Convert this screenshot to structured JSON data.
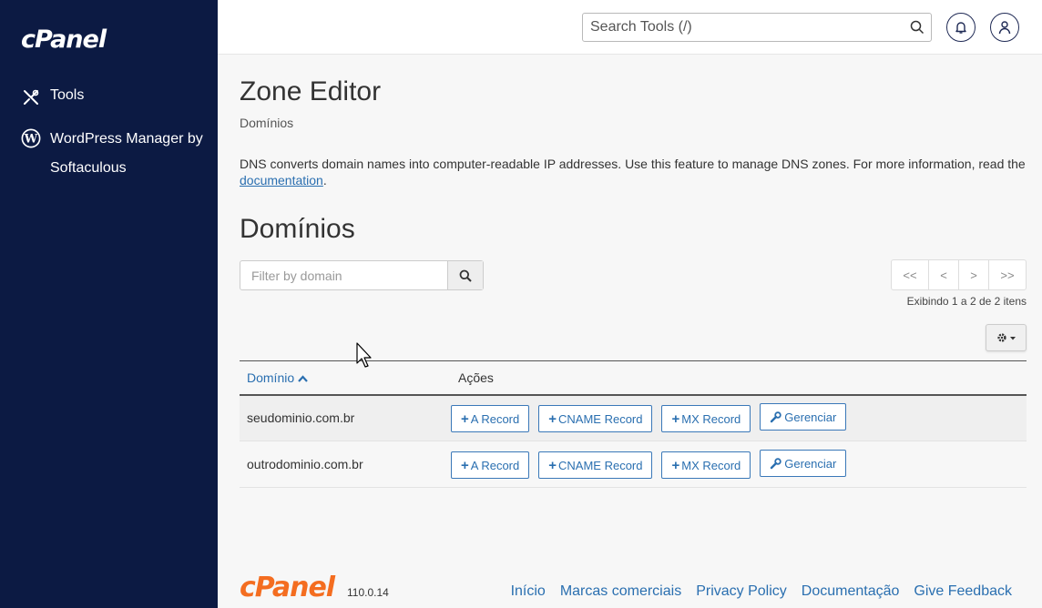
{
  "sidebar": {
    "logo": "cPanel",
    "items": [
      {
        "label": "Tools",
        "icon": "tools-icon"
      },
      {
        "label": "WordPress Manager by Softaculous",
        "icon": "wordpress-icon"
      }
    ]
  },
  "header": {
    "search_placeholder": "Search Tools (/)"
  },
  "main": {
    "title": "Zone Editor",
    "breadcrumb": "Domínios",
    "description_text": "DNS converts domain names into computer-readable IP addresses. Use this feature to manage DNS zones. For more information, read the ",
    "description_link": "documentation",
    "description_end": ".",
    "section_title": "Domínios",
    "filter_placeholder": "Filter by domain",
    "pager": {
      "first": "<<",
      "prev": "<",
      "next": ">",
      "last": ">>"
    },
    "showing": "Exibindo 1 a 2 de 2 itens",
    "table": {
      "col_domain": "Domínio",
      "col_actions": "Ações",
      "rows": [
        {
          "domain": "seudominio.com.br"
        },
        {
          "domain": "outrodominio.com.br"
        }
      ],
      "actions": {
        "a_record": "A Record",
        "cname_record": "CNAME Record",
        "mx_record": "MX Record",
        "manage": "Gerenciar"
      }
    }
  },
  "footer": {
    "logo": "cPanel",
    "version": "110.0.14",
    "links": [
      "Início",
      "Marcas comerciais",
      "Privacy Policy",
      "Documentação",
      "Give Feedback"
    ]
  },
  "colors": {
    "sidebar_bg": "#0c1a43",
    "link": "#2a6fb0",
    "brand_orange": "#f46d20"
  }
}
